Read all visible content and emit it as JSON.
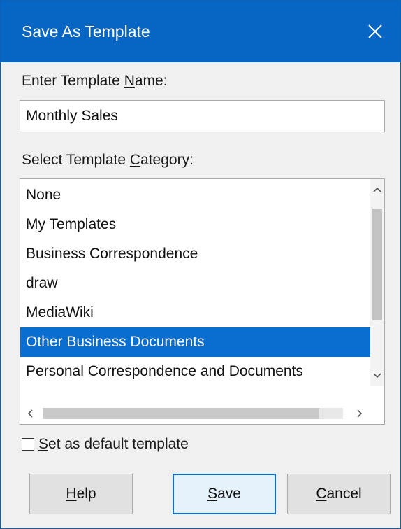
{
  "dialog": {
    "title": "Save As Template"
  },
  "name_field": {
    "label_before": "Enter Template ",
    "label_accel": "N",
    "label_after": "ame:",
    "value": "Monthly Sales"
  },
  "category": {
    "label_before": "Select Template ",
    "label_accel": "C",
    "label_after": "ategory:",
    "items": [
      "None",
      "My Templates",
      "Business Correspondence",
      "draw",
      "MediaWiki",
      "Other Business Documents",
      "Personal Correspondence and Documents"
    ],
    "selected": "Other Business Documents"
  },
  "default_checkbox": {
    "label_accel": "S",
    "label_rest": "et as default template",
    "checked": false
  },
  "buttons": {
    "help_accel": "H",
    "help_rest": "elp",
    "save_accel": "S",
    "save_rest": "ave",
    "cancel_accel": "C",
    "cancel_rest": "ancel"
  },
  "icons": {
    "close": "close-icon",
    "scroll_up": "chevron-up-icon",
    "scroll_down": "chevron-down-icon",
    "scroll_left": "chevron-left-icon",
    "scroll_right": "chevron-right-icon"
  },
  "colors": {
    "titlebar": "#0766c4",
    "selection": "#0a6ed1"
  }
}
